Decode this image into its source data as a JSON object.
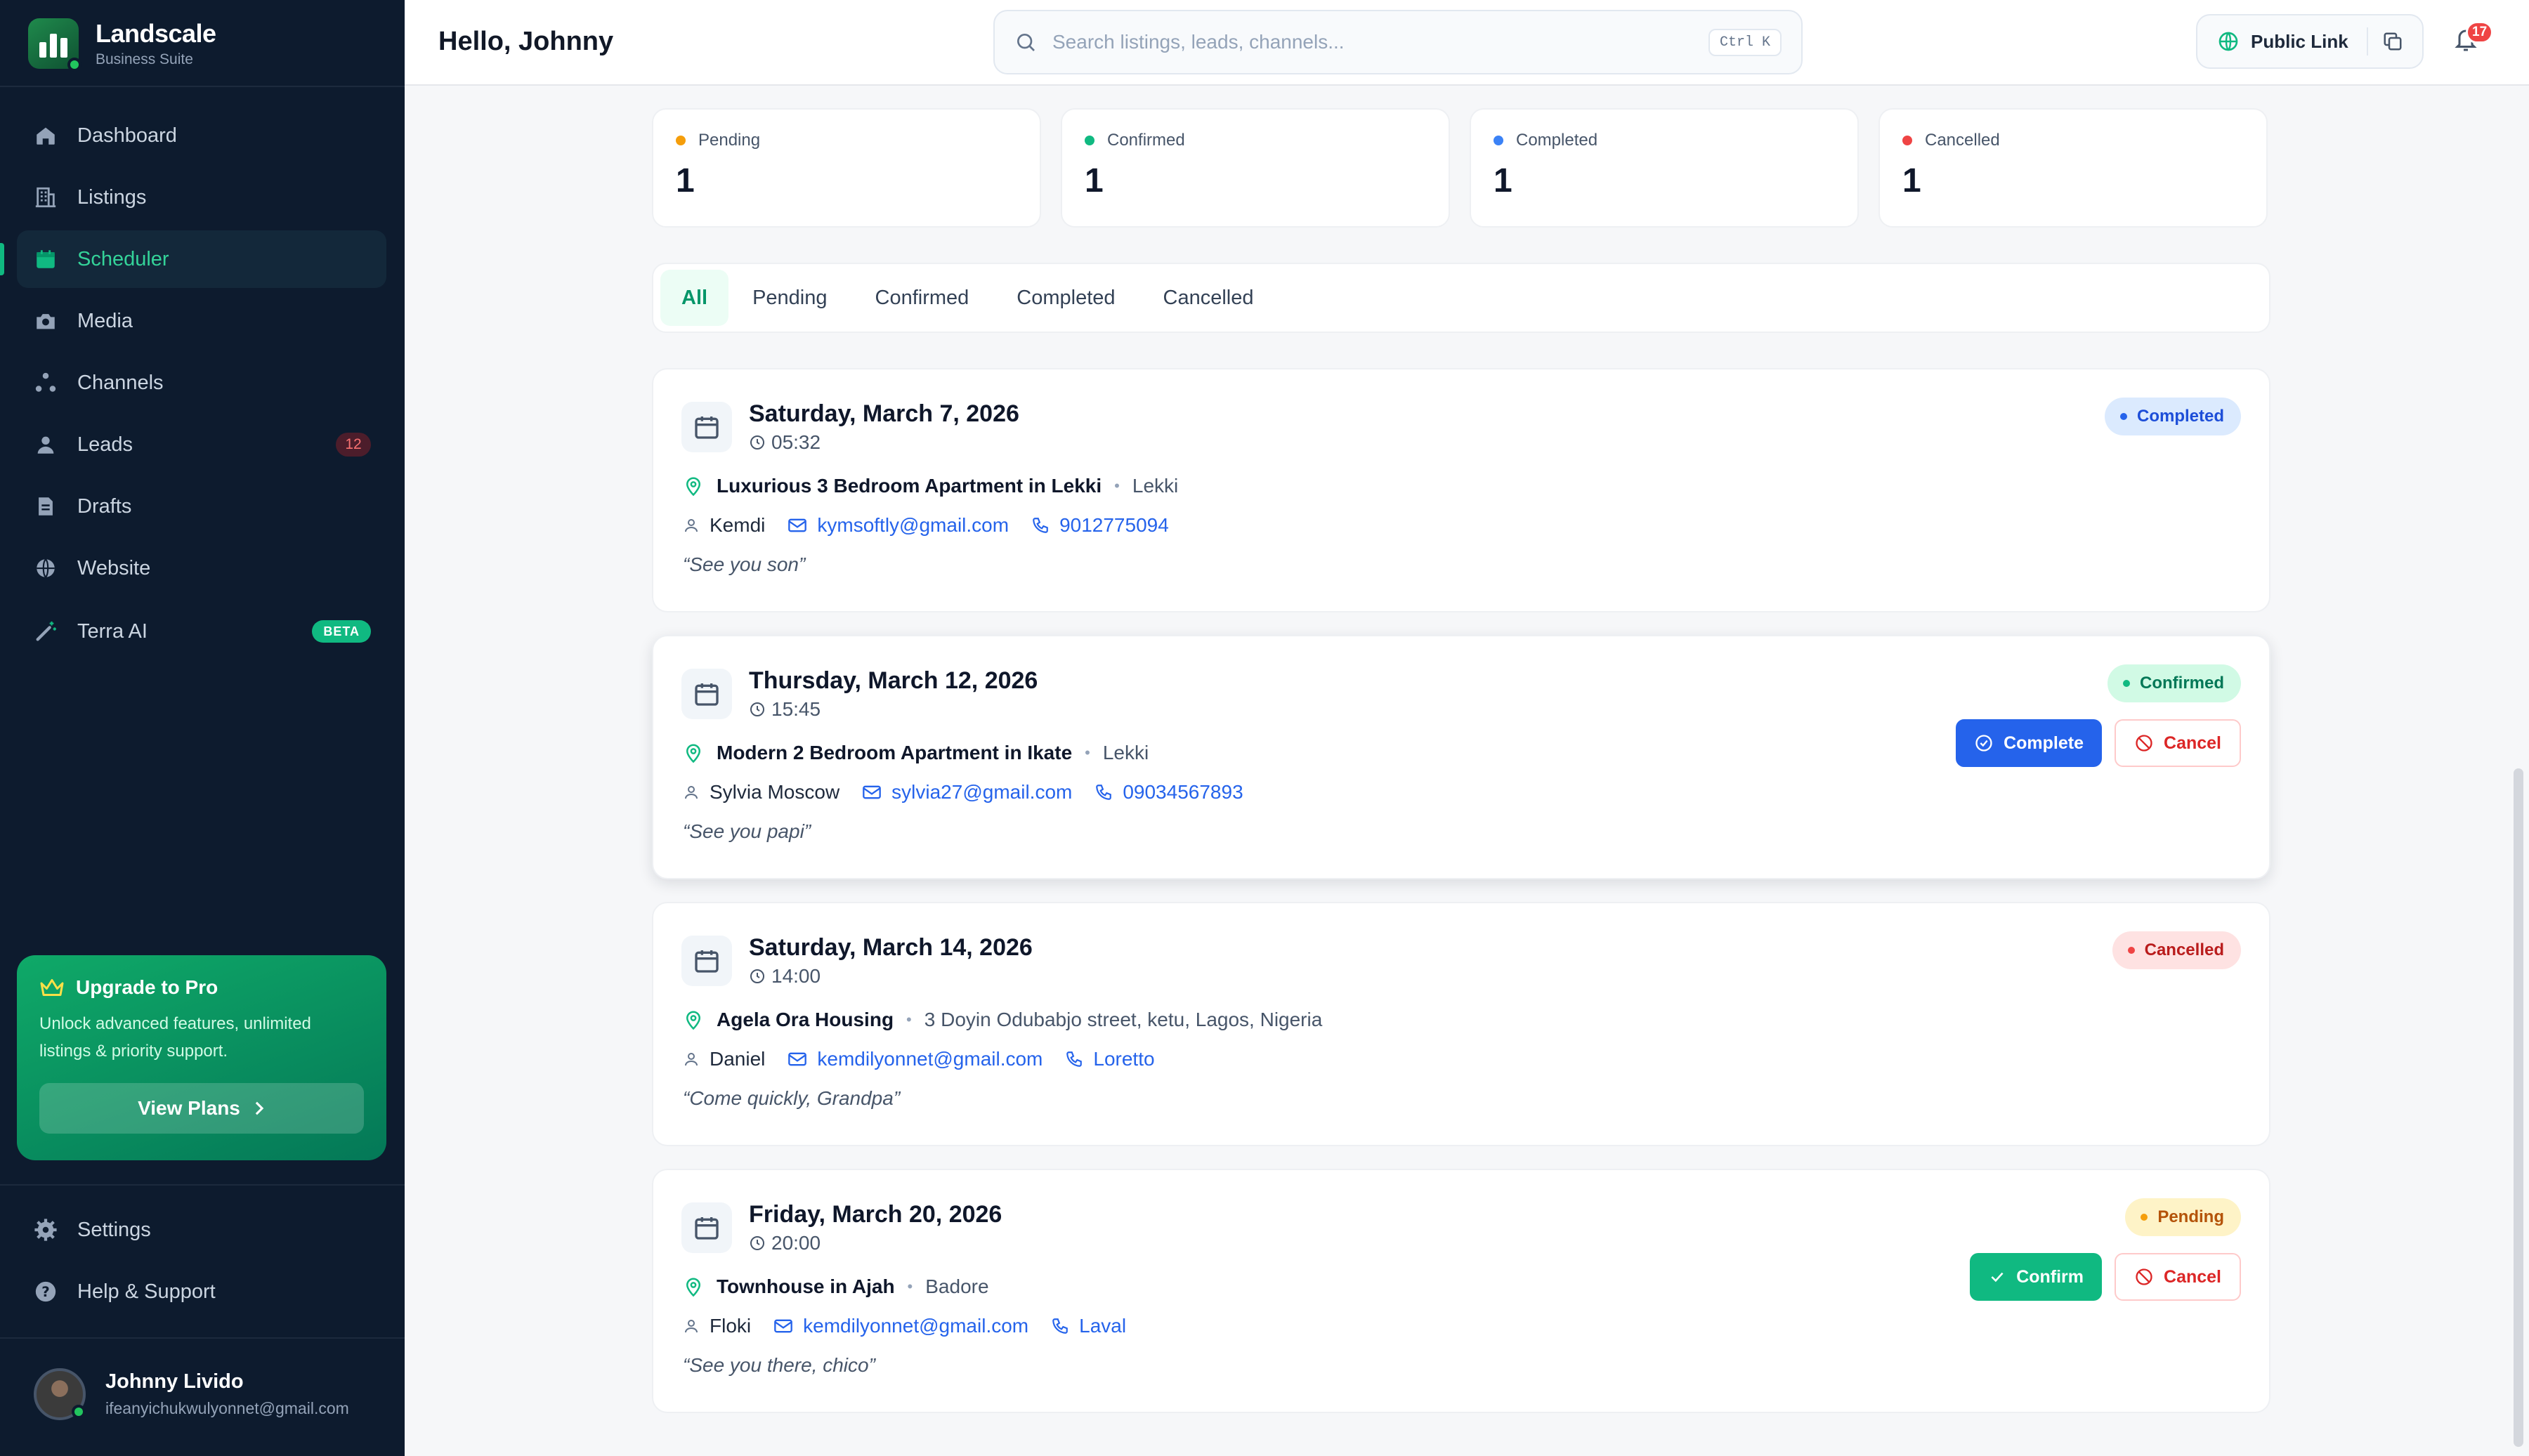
{
  "app": {
    "name": "Landscale",
    "subtitle": "Business Suite"
  },
  "sidebar": {
    "items": [
      {
        "label": "Dashboard",
        "icon": "home-icon"
      },
      {
        "label": "Listings",
        "icon": "building-icon"
      },
      {
        "label": "Scheduler",
        "icon": "calendar-icon",
        "active": true
      },
      {
        "label": "Media",
        "icon": "camera-icon"
      },
      {
        "label": "Channels",
        "icon": "share-icon"
      },
      {
        "label": "Leads",
        "icon": "users-icon",
        "badge": "12"
      },
      {
        "label": "Drafts",
        "icon": "file-icon"
      },
      {
        "label": "Website",
        "icon": "globe-icon"
      },
      {
        "label": "Terra AI",
        "icon": "magic-wand-icon",
        "badge": "BETA"
      }
    ],
    "bottom_items": [
      {
        "label": "Settings",
        "icon": "gear-icon"
      },
      {
        "label": "Help & Support",
        "icon": "help-icon"
      }
    ],
    "upgrade": {
      "title": "Upgrade to Pro",
      "description": "Unlock advanced features, unlimited listings & priority support.",
      "button": "View Plans"
    },
    "user": {
      "name": "Johnny Livido",
      "email": "ifeanyichukwulyonnet@gmail.com"
    }
  },
  "header": {
    "greeting": "Hello, Johnny",
    "search": {
      "placeholder": "Search listings, leads, channels...",
      "shortcut": "Ctrl K"
    },
    "public_link": "Public Link",
    "notifications": "17"
  },
  "stats": [
    {
      "label": "Pending",
      "value": "1",
      "color": "#f59e0b"
    },
    {
      "label": "Confirmed",
      "value": "1",
      "color": "#10b981"
    },
    {
      "label": "Completed",
      "value": "1",
      "color": "#3b82f6"
    },
    {
      "label": "Cancelled",
      "value": "1",
      "color": "#ef4444"
    }
  ],
  "tabs": [
    "All",
    "Pending",
    "Confirmed",
    "Completed",
    "Cancelled"
  ],
  "active_tab": "All",
  "appointments": [
    {
      "date": "Saturday, March 7, 2026",
      "time": "05:32",
      "listing": "Luxurious 3 Bedroom Apartment in Lekki",
      "area": "Lekki",
      "name": "Kemdi",
      "email": "kymsoftly@gmail.com",
      "phone": "9012775094",
      "note": "“See you son”",
      "status": "Completed"
    },
    {
      "date": "Thursday, March 12, 2026",
      "time": "15:45",
      "listing": "Modern 2 Bedroom Apartment in Ikate",
      "area": "Lekki",
      "name": "Sylvia Moscow",
      "email": "sylvia27@gmail.com",
      "phone": "09034567893",
      "note": "“See you papi”",
      "status": "Confirmed",
      "primary_action": "Complete",
      "cancel_action": "Cancel"
    },
    {
      "date": "Saturday, March 14, 2026",
      "time": "14:00",
      "listing": "Agela Ora Housing",
      "area": "3 Doyin Odubabjo street, ketu, Lagos, Nigeria",
      "name": "Daniel",
      "email": "kemdilyonnet@gmail.com",
      "phone": "Loretto",
      "note": "“Come quickly, Grandpa”",
      "status": "Cancelled"
    },
    {
      "date": "Friday, March 20, 2026",
      "time": "20:00",
      "listing": "Townhouse in Ajah",
      "area": "Badore",
      "name": "Floki",
      "email": "kemdilyonnet@gmail.com",
      "phone": "Laval",
      "note": "“See you there, chico”",
      "status": "Pending",
      "primary_action": "Confirm",
      "cancel_action": "Cancel"
    }
  ]
}
